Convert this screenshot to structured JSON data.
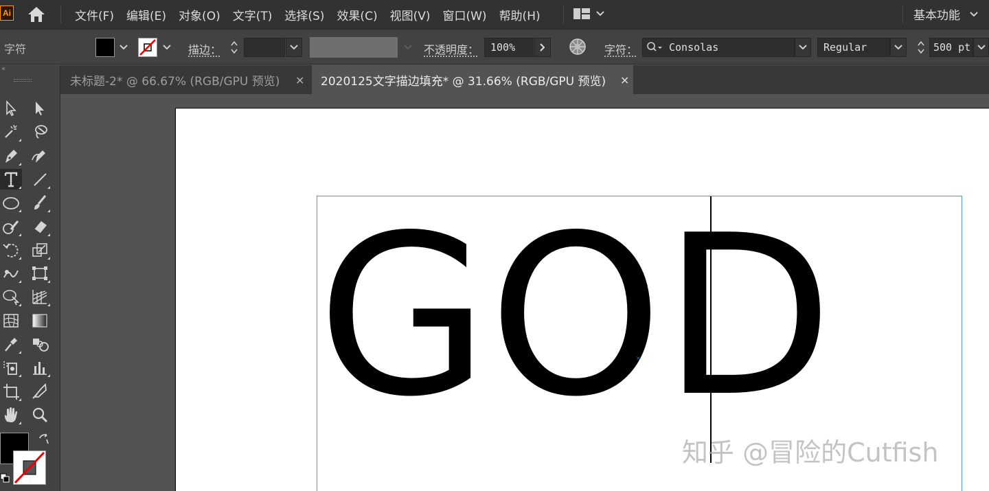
{
  "app": {
    "logo_text": "Ai"
  },
  "menu": {
    "items": [
      "文件(F)",
      "编辑(E)",
      "对象(O)",
      "文字(T)",
      "选择(S)",
      "效果(C)",
      "视图(V)",
      "窗口(W)",
      "帮助(H)"
    ],
    "workspace": "基本功能"
  },
  "control_bar": {
    "panel_label": "字符",
    "stroke_label": "描边：",
    "opacity_label": "不透明度：",
    "opacity_value": "100%",
    "character_label": "字符：",
    "font_family": "Consolas",
    "font_style": "Regular",
    "font_size": "500 pt",
    "fill_color": "#000000",
    "stroke_color": "none"
  },
  "tabs": [
    {
      "label": "未标题-2* @ 66.67% (RGB/GPU 预览)",
      "active": false
    },
    {
      "label": "2020125文字描边填充* @ 31.66% (RGB/GPU 预览)",
      "active": true
    }
  ],
  "tab_close_glyph": "×",
  "canvas": {
    "text": "GOD",
    "anchor_glyph": "×",
    "watermark": "知乎 @冒险的Cutfish"
  },
  "colors": {
    "menubar_bg": "#323232",
    "panel_bg": "#424242",
    "pasteboard": "#535353",
    "artboard": "#ffffff",
    "frame_blue": "#5a8dd6",
    "ai_orange": "#ff9a00"
  },
  "tools": [
    "selection-tool",
    "direct-selection-tool",
    "magic-wand-tool",
    "lasso-tool",
    "pen-tool",
    "curvature-tool",
    "type-tool",
    "line-segment-tool",
    "ellipse-tool",
    "paintbrush-tool",
    "shaper-tool",
    "eraser-tool",
    "rotate-tool",
    "scale-tool",
    "warp-tool",
    "free-transform-tool",
    "shape-builder-tool",
    "perspective-grid-tool",
    "mesh-tool",
    "gradient-tool",
    "eyedropper-tool",
    "blend-tool",
    "symbol-sprayer-tool",
    "column-graph-tool",
    "artboard-tool",
    "slice-tool",
    "hand-tool",
    "zoom-tool"
  ]
}
